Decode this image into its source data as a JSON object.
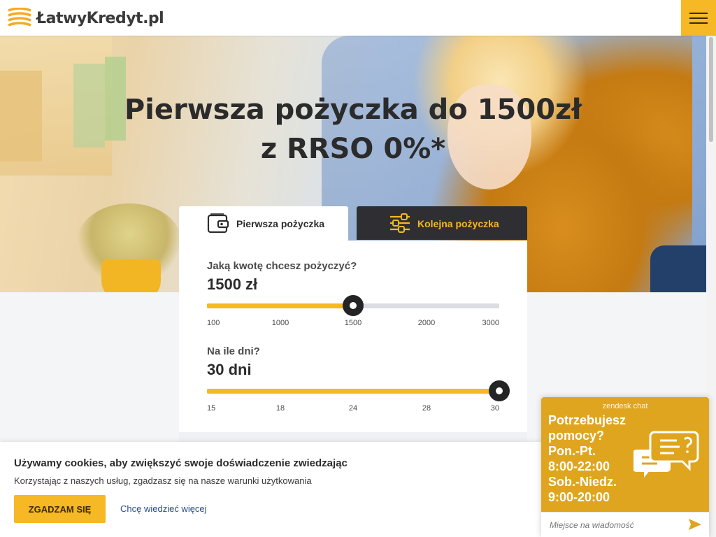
{
  "header": {
    "logo_text": "ŁatwyKredyt.pl",
    "menu_icon": "hamburger-icon"
  },
  "hero": {
    "title_line1": "Pierwsza pożyczka do 1500zł",
    "title_line2": "z RRSO 0%*"
  },
  "tabs": [
    {
      "label": "Pierwsza pożyczka",
      "icon": "wallet-icon",
      "active": true
    },
    {
      "label": "Kolejna pożyczka",
      "icon": "sliders-icon",
      "active": false
    }
  ],
  "calculator": {
    "amount": {
      "question": "Jaką kwotę chcesz pożyczyć?",
      "value": "1500 zł",
      "ticks": [
        "100",
        "1000",
        "1500",
        "2000",
        "3000"
      ],
      "selected_index": 2,
      "fill_fraction": 0.5
    },
    "days": {
      "question": "Na ile dni?",
      "value": "30 dni",
      "ticks": [
        "15",
        "18",
        "24",
        "28",
        "30"
      ],
      "selected_index": 4,
      "fill_fraction": 1.0
    }
  },
  "cookie": {
    "title": "Używamy cookies, aby zwiększyć swoje doświadczenie zwiedzając",
    "text": "Korzystając z naszych usług, zgadzasz się na nasze warunki użytkowania",
    "accept_label": "ZGADZAM SIĘ",
    "more_label": "Chcę wiedzieć więcej"
  },
  "chat": {
    "brand": "zendesk chat",
    "message_lines": [
      "Potrzebujesz",
      "pomocy?",
      "Pon.-Pt.",
      "8:00-22:00",
      "Sob.-Niedz.",
      "9:00-20:00"
    ],
    "input_placeholder": "Miejsce na wiadomość",
    "send_icon": "send-icon",
    "bubble_icon": "chat-bubbles-icon"
  },
  "colors": {
    "accent": "#f6b825",
    "dark_tab": "#2f2f33",
    "chat": "#e0a51e"
  }
}
